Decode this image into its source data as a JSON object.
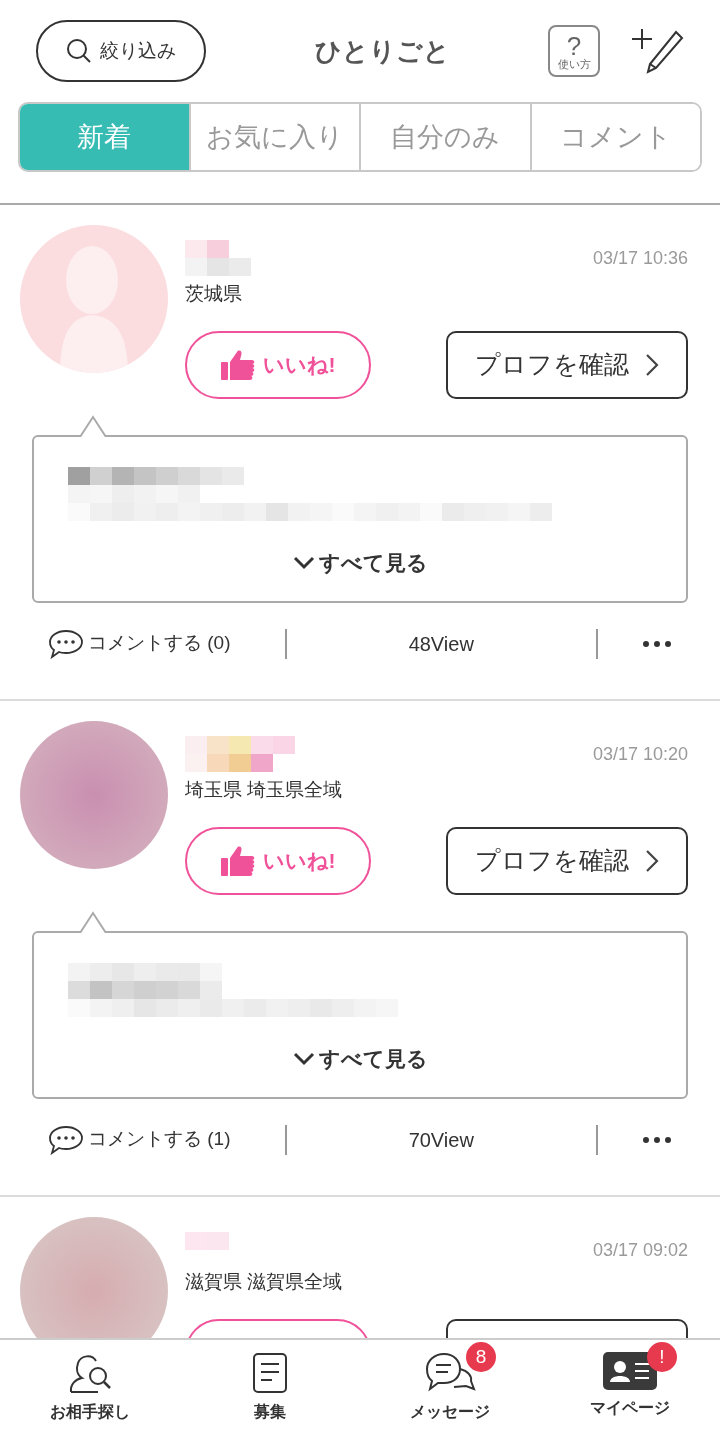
{
  "header": {
    "filter_button": "絞り込み",
    "title": "ひとりごと",
    "help_icon": "?",
    "help_button": "使い方"
  },
  "tabs": [
    {
      "label": "新着",
      "selected": true
    },
    {
      "label": "お気に入り",
      "selected": false
    },
    {
      "label": "自分のみ",
      "selected": false
    },
    {
      "label": "コメント",
      "selected": false
    }
  ],
  "posts": [
    {
      "kind": "silhouette",
      "time": "03/17 10:36",
      "location": "茨城県",
      "like_button": "いいね!",
      "profile_button": "プロフを確認",
      "see_all": "すべて見る",
      "comment_link": "コメントする (0)",
      "views": "48View"
    },
    {
      "kind": "blur",
      "time": "03/17 10:20",
      "location": "埼玉県 埼玉県全域",
      "like_button": "いいね!",
      "profile_button": "プロフを確認",
      "see_all": "すべて見る",
      "comment_link": "コメントする (1)",
      "views": "70View"
    },
    {
      "kind": "blur",
      "time": "03/17 09:02",
      "location": "滋賀県 滋賀県全域"
    }
  ],
  "bottom_nav": [
    {
      "label": "お相手探し",
      "kind": "search-person",
      "selected": false
    },
    {
      "label": "募集",
      "kind": "document",
      "selected": false
    },
    {
      "label": "メッセージ",
      "kind": "chat",
      "selected": false,
      "badge": "8"
    },
    {
      "label": "マイページ",
      "kind": "profile-card",
      "selected": false,
      "badge": "!"
    }
  ]
}
